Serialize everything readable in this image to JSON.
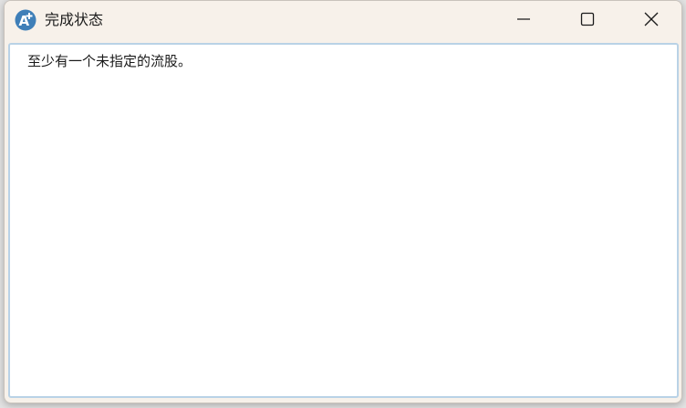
{
  "window": {
    "title": "完成状态",
    "icon": "app-a-plus-icon",
    "controls": {
      "minimize": "minimize-icon",
      "maximize": "maximize-icon",
      "close": "close-icon"
    }
  },
  "content": {
    "message": "至少有一个未指定的流股。"
  },
  "colors": {
    "titlebar": "#f7f1ea",
    "icon_blue": "#3f7fb8",
    "content_border": "#b9d2e6"
  }
}
